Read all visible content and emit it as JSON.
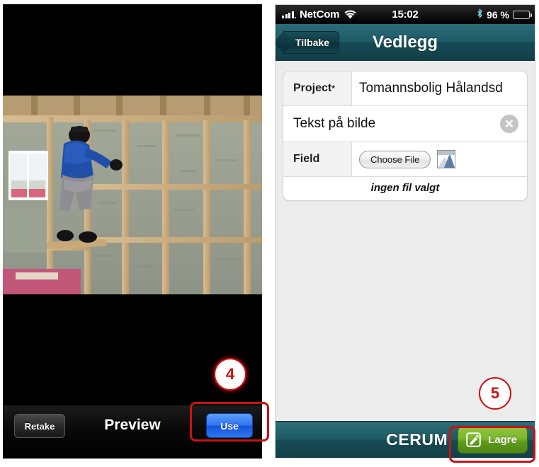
{
  "left_panel": {
    "name": "camera-preview-screen",
    "title": "Preview",
    "retake_label": "Retake",
    "use_label": "Use",
    "photo": {
      "alt": "Construction worker in blue jacket installing mineral wool insulation between timber wall studs",
      "colors": {
        "timber": "#cbab7e",
        "insulation": "#9aa391",
        "jacket": "#1f4fa8",
        "pants": "#8d8d93",
        "window": "#f2f2f2",
        "floor": "#6d5a44"
      }
    }
  },
  "right_panel": {
    "name": "vedlegg-form-screen",
    "status_bar": {
      "carrier": "NetCom",
      "time": "15:02",
      "battery_percent": "96 %",
      "icons": [
        "signal-bars-icon",
        "wifi-icon",
        "bluetooth-icon",
        "battery-icon"
      ]
    },
    "nav_bar": {
      "back_label": "Tilbake",
      "title": "Vedlegg",
      "accent_color": "#1d5b66"
    },
    "form": {
      "project": {
        "label": "Project",
        "required_marker": "*",
        "value": "Tomannsbolig Hålandsd"
      },
      "caption": {
        "value": "Tekst på bilde",
        "clear_label": "✕"
      },
      "file": {
        "label": "Field",
        "choose_file_label": "Choose File",
        "thumbnail": "image-thumbnail-icon",
        "status": "ingen fil valgt"
      }
    },
    "bottom_bar": {
      "brand": "CERUM",
      "save_label": "Lagre",
      "save_icon": "edit-pencil-icon",
      "save_color": "#7ab62c"
    }
  },
  "annotations": {
    "callouts": [
      {
        "number": "4",
        "target": "use-button"
      },
      {
        "number": "5",
        "target": "save-button"
      }
    ],
    "highlight_color": "#cc1111"
  }
}
